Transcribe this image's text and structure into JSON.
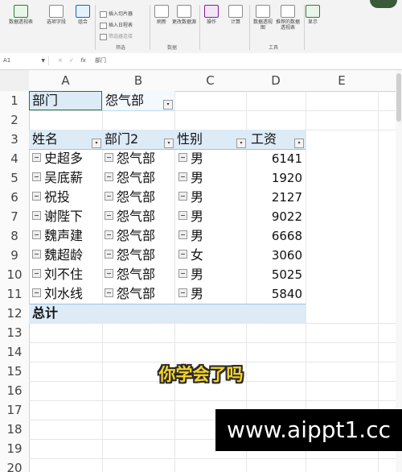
{
  "ribbon": {
    "buttons": [
      {
        "label": "数据透视表",
        "icon": "pivot-table-icon"
      },
      {
        "label": "选项字段",
        "icon": "field-list-icon"
      },
      {
        "label": "组合",
        "icon": "group-icon"
      },
      {
        "label": "刷新",
        "icon": "refresh-icon"
      },
      {
        "label": "更改数据源",
        "icon": "change-source-icon"
      },
      {
        "label": "操作",
        "icon": "actions-icon"
      },
      {
        "label": "计算",
        "icon": "calculate-icon"
      },
      {
        "label": "数据透视图",
        "icon": "pivot-chart-icon"
      },
      {
        "label": "推荐的数据透视表",
        "icon": "recommended-pivot-icon"
      },
      {
        "label": "显示",
        "icon": "show-icon"
      }
    ],
    "small_items": [
      "插入切片器",
      "插入日程表",
      "筛选器连接"
    ],
    "group_labels": {
      "filter": "筛选",
      "data": "数据",
      "tools": "工具"
    }
  },
  "formula_bar": {
    "name_box": "A1",
    "fx": "fx",
    "cancel": "×",
    "confirm": "✓",
    "content": "部门"
  },
  "grid": {
    "columns": [
      "A",
      "B",
      "C",
      "D",
      "E"
    ],
    "rows": [
      "1",
      "2",
      "3",
      "4",
      "5",
      "6",
      "7",
      "8",
      "9",
      "10",
      "11",
      "12",
      "13",
      "14",
      "15",
      "16",
      "17",
      "18",
      "19",
      "20"
    ]
  },
  "pivot": {
    "filter_label": "部门",
    "filter_value": "怨气部",
    "headers": [
      "姓名",
      "部门2",
      "性别",
      "工资"
    ],
    "rows": [
      {
        "name": "史超多",
        "dept": "怨气部",
        "gender": "男",
        "salary": "6141"
      },
      {
        "name": "吴底薪",
        "dept": "怨气部",
        "gender": "男",
        "salary": "1920"
      },
      {
        "name": "祝投",
        "dept": "怨气部",
        "gender": "男",
        "salary": "2127"
      },
      {
        "name": "谢陛下",
        "dept": "怨气部",
        "gender": "男",
        "salary": "9022"
      },
      {
        "name": "魏声建",
        "dept": "怨气部",
        "gender": "男",
        "salary": "6668"
      },
      {
        "name": "魏超龄",
        "dept": "怨气部",
        "gender": "女",
        "salary": "3060"
      },
      {
        "name": "刘不住",
        "dept": "怨气部",
        "gender": "男",
        "salary": "5025"
      },
      {
        "name": "刘水线",
        "dept": "怨气部",
        "gender": "男",
        "salary": "5840"
      }
    ],
    "total_label": "总计"
  },
  "overlay": {
    "caption": "你学会了吗",
    "watermark": "www.aippt1.cc"
  },
  "colors": {
    "pivot_header": "#ddebf7",
    "caption": "#f6d32b",
    "watermark_bg": "#000000"
  }
}
